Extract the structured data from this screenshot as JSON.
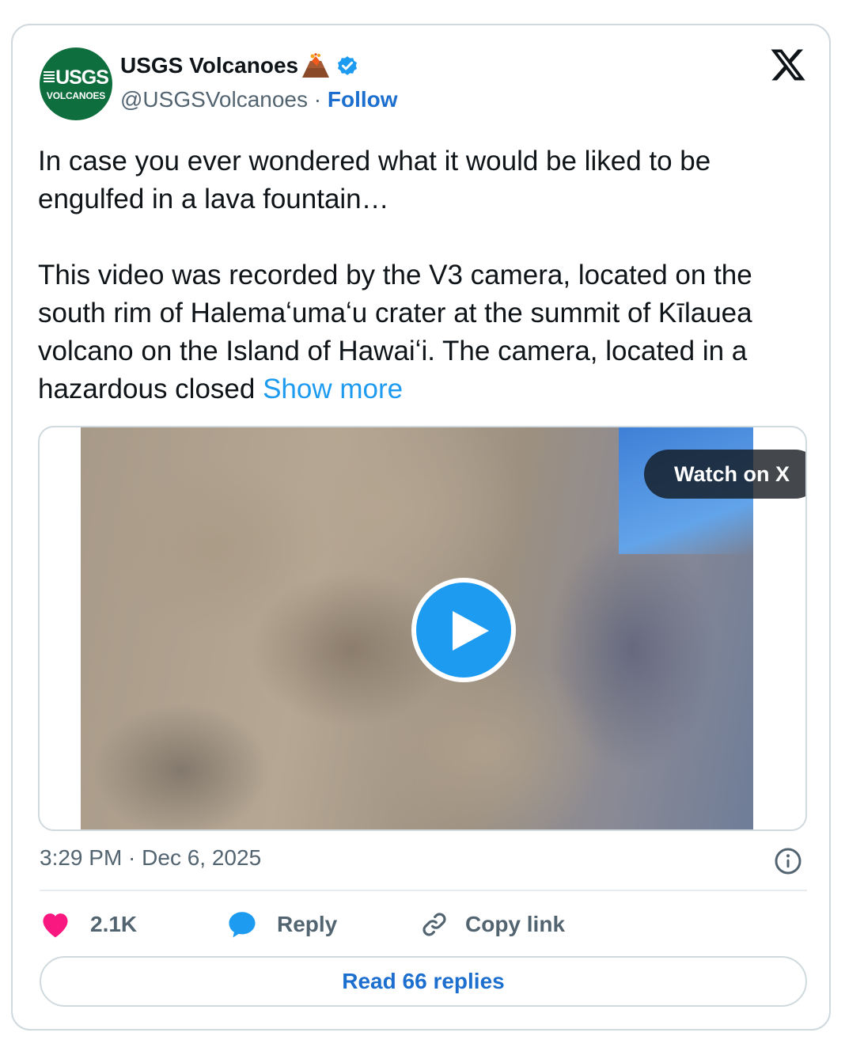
{
  "author": {
    "avatar_line1": "USGS",
    "avatar_line2": "VOLCANOES",
    "name": "USGS Volcanoes",
    "handle": "@USGSVolcanoes",
    "separator": "·",
    "follow_label": "Follow",
    "name_emoji_icon": "volcano-icon",
    "verified_icon": "verified-badge-icon"
  },
  "tweet": {
    "paragraph1": "In case you ever wondered what it would be liked to be engulfed in a lava fountain…",
    "paragraph2": "This video was recorded by the V3 camera, located on the south rim of Halemaʻumaʻu crater at the summit of Kīlauea volcano on the Island of Hawaiʻi. The camera, located in a hazardous closed",
    "show_more": "Show more"
  },
  "media": {
    "watch_label": "Watch on X",
    "play_icon": "play-icon"
  },
  "timestamp": "3:29 PM · Dec 6, 2025",
  "actions": {
    "like_count": "2.1K",
    "reply_label": "Reply",
    "copy_link_label": "Copy link"
  },
  "read_replies_label": "Read 66 replies",
  "colors": {
    "accent": "#1d9bf0",
    "link": "#1d6fcf",
    "like": "#f91880",
    "avatar_bg": "#0f6e3d",
    "border": "#cfd9de"
  }
}
